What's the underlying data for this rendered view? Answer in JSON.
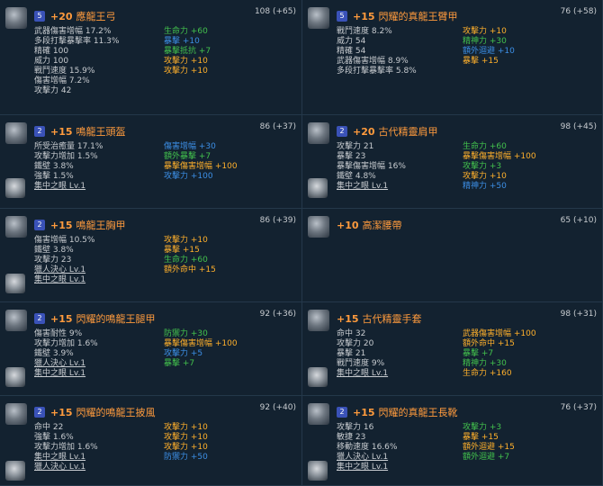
{
  "cards": [
    {
      "score": "108 (+65)",
      "badge": "5",
      "plus": "+20",
      "name": "應龍王弓",
      "left": [
        "武器傷害增幅 17.2%",
        "多段打擊暴擊率 11.3%",
        "精確 100",
        "威力 100",
        "戰鬥速度 15.9%",
        "傷害增幅 7.2%",
        "攻擊力 42"
      ],
      "right": [
        [
          "生命力 +60",
          "g"
        ],
        [
          "暴擊 +10",
          "b"
        ],
        [
          "暴擊抵抗 +7",
          "g"
        ],
        [
          "攻擊力 +10",
          "o"
        ],
        [
          "攻擊力 +10",
          "o"
        ]
      ]
    },
    {
      "score": "76 (+58)",
      "badge": "5",
      "plus": "+15",
      "name": "閃耀的真龍王臂甲",
      "left": [
        "戰鬥速度 8.2%",
        "威力 54",
        "精確 54",
        "武器傷害增幅 8.9%",
        "多段打擊暴擊率 5.8%"
      ],
      "right": [
        [
          "攻擊力 +10",
          "o"
        ],
        [
          "精神力 +30",
          "g"
        ],
        [
          "額外迴避 +10",
          "b"
        ],
        [
          "暴擊 +15",
          "o"
        ]
      ]
    },
    {
      "score": "86 (+37)",
      "badge": "2",
      "plus": "+15",
      "name": "鳴龍王頭盔",
      "left": [
        "所受治癒量 17.1%",
        "攻擊力增加 1.5%",
        "鐵壁 3.8%",
        "強擊 1.5%",
        "集中之眼 Lv.1"
      ],
      "right": [
        [
          "傷害增幅 +30",
          "b"
        ],
        [
          "額外暴擊 +7",
          "g"
        ],
        [
          "暴擊傷害增幅 +100",
          "o"
        ],
        [
          "攻擊力 +100",
          "b"
        ]
      ]
    },
    {
      "score": "98 (+45)",
      "badge": "2",
      "plus": "+20",
      "name": "古代精靈肩甲",
      "left": [
        "攻擊力 21",
        "暴擊 23",
        "暴擊傷害增幅 16%",
        "鐵壁 4.8%",
        "集中之眼 Lv.1"
      ],
      "right": [
        [
          "生命力 +60",
          "g"
        ],
        [
          "暴擊傷害增幅 +100",
          "o"
        ],
        [
          "攻擊力 +3",
          "g"
        ],
        [
          "攻擊力 +10",
          "o"
        ],
        [
          "精神力 +50",
          "b"
        ]
      ]
    },
    {
      "score": "86 (+39)",
      "badge": "2",
      "plus": "+15",
      "name": "鳴龍王胸甲",
      "left": [
        "傷害增幅 10.5%",
        "鐵壁 3.8%",
        "攻擊力 23",
        "獵人決心 Lv.1",
        "集中之眼 Lv.1"
      ],
      "right": [
        [
          "攻擊力 +10",
          "o"
        ],
        [
          "暴擊 +15",
          "o"
        ],
        [
          "生命力 +60",
          "g"
        ],
        [
          "額外命中 +15",
          "o"
        ]
      ]
    },
    {
      "score": "65 (+10)",
      "badge": "",
      "plus": "+10",
      "name": "高潔腰帶",
      "left": [],
      "right": []
    },
    {
      "score": "92 (+36)",
      "badge": "2",
      "plus": "+15",
      "name": "閃耀的鳴龍王腿甲",
      "left": [
        "傷害耐性 9%",
        "攻擊力增加 1.6%",
        "鐵壁 3.9%",
        "獵人決心 Lv.1",
        "集中之眼 Lv.1"
      ],
      "right": [
        [
          "防禦力 +30",
          "g"
        ],
        [
          "暴擊傷害增幅 +100",
          "o"
        ],
        [
          "攻擊力 +5",
          "b"
        ],
        [
          "暴擊 +7",
          "g"
        ]
      ]
    },
    {
      "score": "98 (+31)",
      "badge": "",
      "plus": "+15",
      "name": "古代精靈手套",
      "left": [
        "命中 32",
        "攻擊力 20",
        "暴擊 21",
        "戰鬥速度 9%",
        "集中之眼 Lv.1"
      ],
      "right": [
        [
          "武器傷害增幅 +100",
          "o"
        ],
        [
          "額外命中 +15",
          "o"
        ],
        [
          "暴擊 +7",
          "g"
        ],
        [
          "精神力 +30",
          "g"
        ],
        [
          "生命力 +160",
          "o"
        ]
      ]
    },
    {
      "score": "92 (+40)",
      "badge": "2",
      "plus": "+15",
      "name": "閃耀的鳴龍王披風",
      "left": [
        "命中 22",
        "強擊 1.6%",
        "攻擊力增加 1.6%",
        "集中之眼 Lv.1",
        "獵人決心 Lv.1"
      ],
      "right": [
        [
          "攻擊力 +10",
          "o"
        ],
        [
          "攻擊力 +10",
          "o"
        ],
        [
          "攻擊力 +10",
          "o"
        ],
        [
          "防禦力 +50",
          "b"
        ]
      ]
    },
    {
      "score": "76 (+37)",
      "badge": "2",
      "plus": "+15",
      "name": "閃耀的真龍王長靴",
      "left": [
        "攻擊力 16",
        "敏捷 23",
        "移動速度 16.6%",
        "獵人決心 Lv.1",
        "集中之眼 Lv.1"
      ],
      "right": [
        [
          "攻擊力 +3",
          "g"
        ],
        [
          "暴擊 +15",
          "o"
        ],
        [
          "額外迴避 +15",
          "o"
        ],
        [
          "額外迴避 +7",
          "g"
        ]
      ]
    }
  ]
}
